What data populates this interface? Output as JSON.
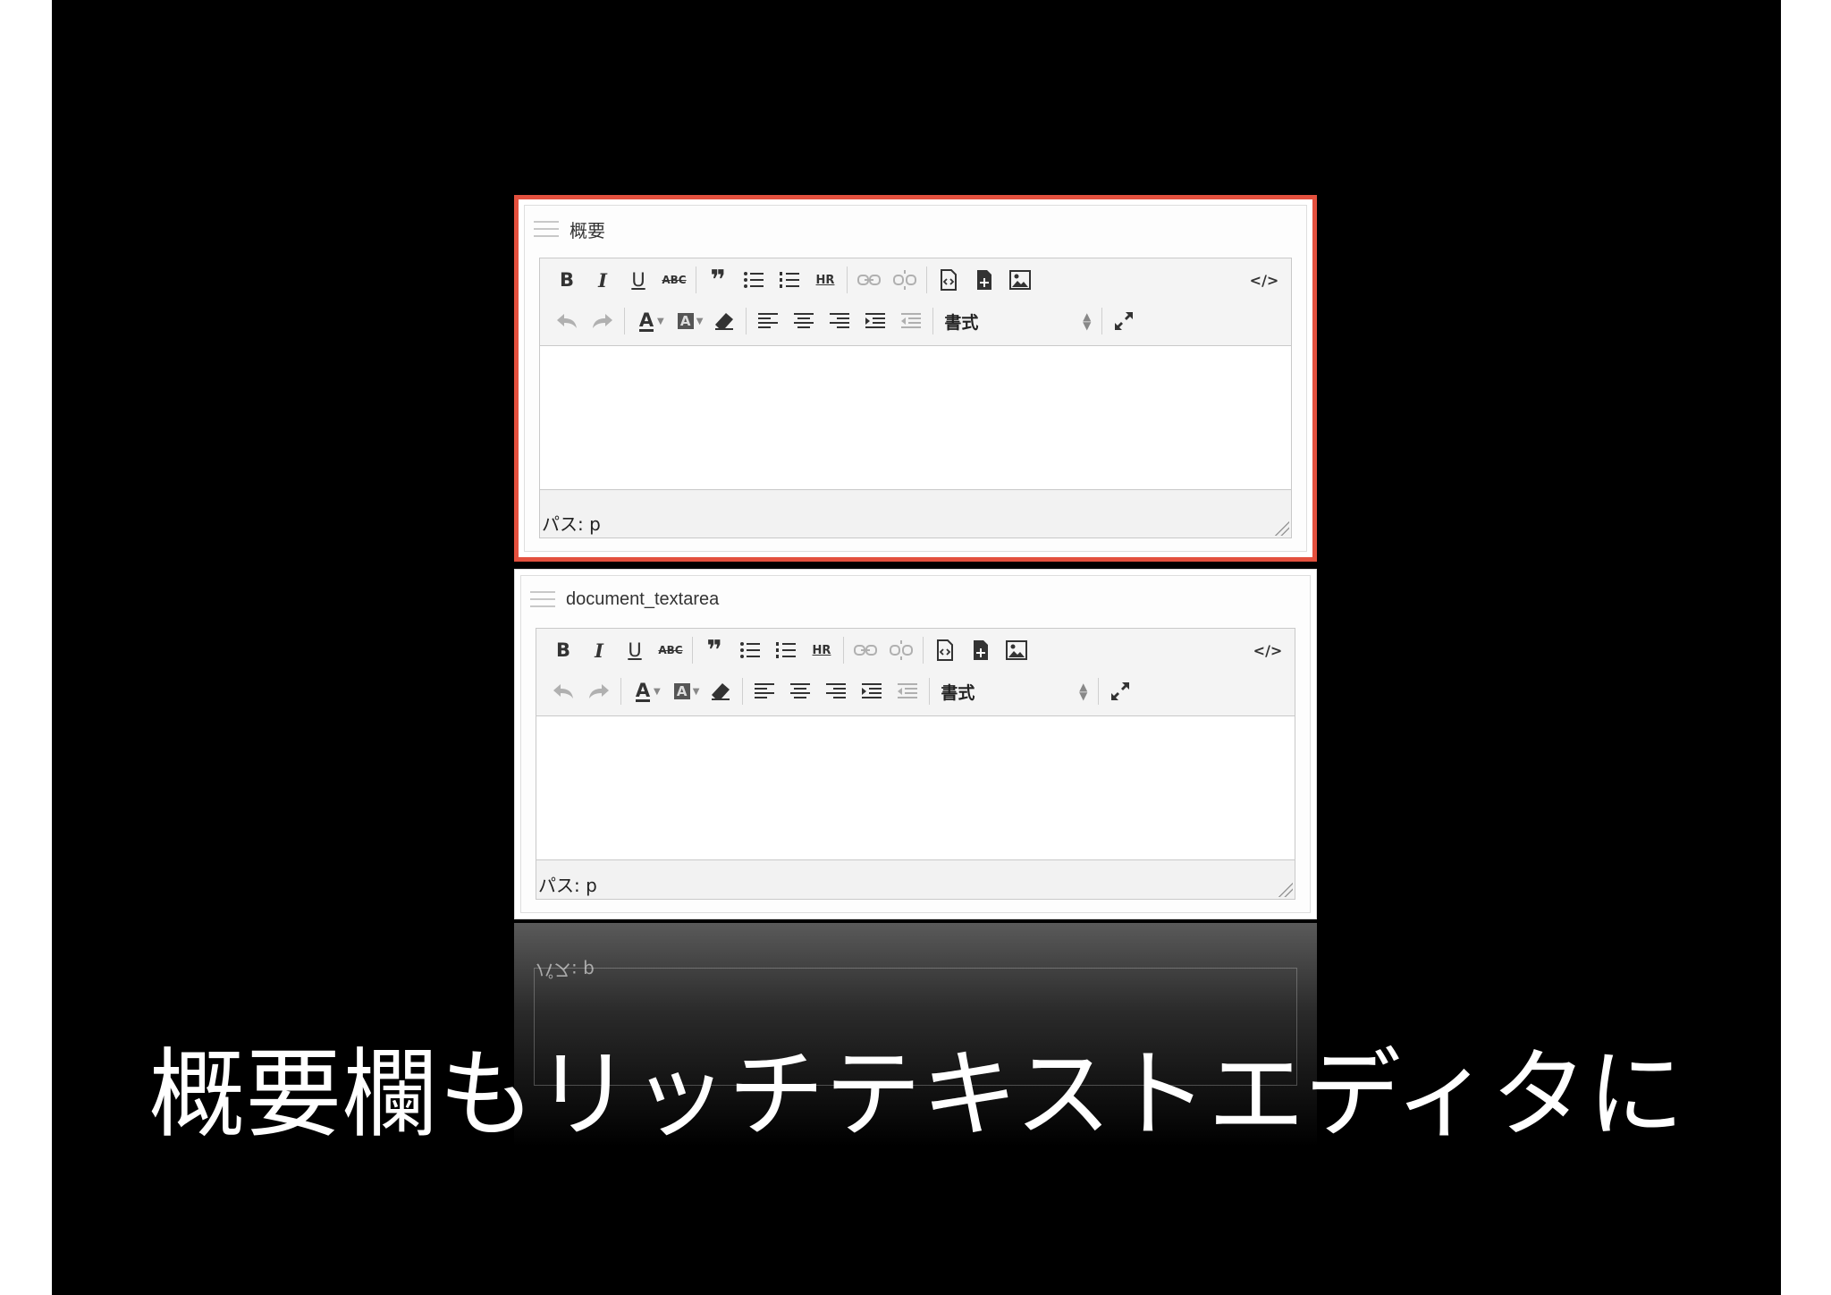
{
  "fields": [
    {
      "title": "概要",
      "highlighted": true,
      "status_path": "パス: p"
    },
    {
      "title": "document_textarea",
      "highlighted": false,
      "status_path": "パス: p"
    }
  ],
  "toolbar": {
    "bold": "B",
    "italic": "I",
    "underline": "U",
    "strike": "ABC",
    "blockquote": "❞",
    "hr": "HR",
    "source": "</>",
    "text_color": "A",
    "bg_color": "A",
    "format_label": "書式"
  },
  "reflection_text": "パス: p",
  "caption": "概要欄もリッチテキストエディタに",
  "colors": {
    "highlight_border": "#e3503e",
    "background": "#000000"
  }
}
